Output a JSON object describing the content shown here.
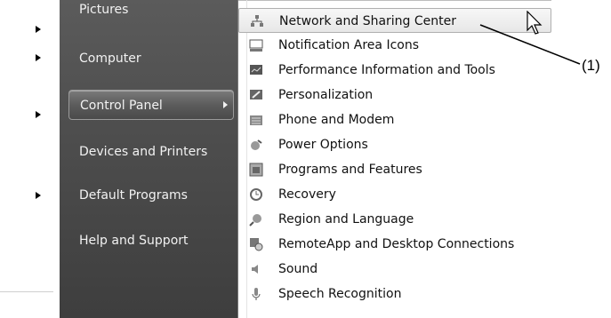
{
  "start_menu": {
    "items": [
      {
        "label": "Pictures",
        "has_submenu": false
      },
      {
        "label": "Computer",
        "has_submenu": false
      },
      {
        "label": "Control Panel",
        "has_submenu": true,
        "selected": true
      },
      {
        "label": "Devices and Printers",
        "has_submenu": false
      },
      {
        "label": "Default Programs",
        "has_submenu": false
      },
      {
        "label": "Help and Support",
        "has_submenu": false
      }
    ]
  },
  "control_panel_flyout": {
    "items": [
      {
        "label": "Network and Sharing Center",
        "icon": "network-icon",
        "hover": true
      },
      {
        "label": "Notification Area Icons",
        "icon": "notification-icon"
      },
      {
        "label": "Performance Information and Tools",
        "icon": "performance-icon"
      },
      {
        "label": "Personalization",
        "icon": "personalization-icon"
      },
      {
        "label": "Phone and Modem",
        "icon": "phone-modem-icon"
      },
      {
        "label": "Power Options",
        "icon": "power-icon"
      },
      {
        "label": "Programs and Features",
        "icon": "programs-icon"
      },
      {
        "label": "Recovery",
        "icon": "recovery-icon"
      },
      {
        "label": "Region and Language",
        "icon": "globe-icon"
      },
      {
        "label": "RemoteApp and Desktop Connections",
        "icon": "remoteapp-icon"
      },
      {
        "label": "Sound",
        "icon": "speaker-icon"
      },
      {
        "label": "Speech Recognition",
        "icon": "microphone-icon"
      }
    ]
  },
  "callout": {
    "label": "(1)"
  },
  "colors": {
    "start_pane": "#4e4e4e",
    "flyout_bg": "#ffffff",
    "hover_border": "#b0b0b0"
  }
}
